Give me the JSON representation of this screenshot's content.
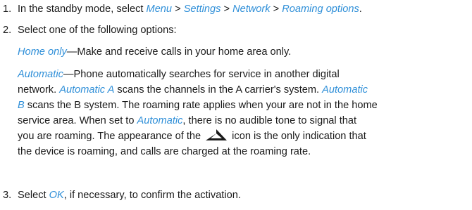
{
  "steps": [
    {
      "number": "1.",
      "parts": [
        {
          "t": "In the standby mode, select "
        },
        {
          "t": "Menu",
          "link": true
        },
        {
          "t": " > "
        },
        {
          "t": "Settings",
          "link": true
        },
        {
          "t": " > "
        },
        {
          "t": "Network",
          "link": true
        },
        {
          "t": " > "
        },
        {
          "t": "Roaming options",
          "link": true
        },
        {
          "t": "."
        }
      ]
    },
    {
      "number": "2.",
      "parts": [
        {
          "t": "Select one of the following options:"
        }
      ]
    },
    {
      "number": "3.",
      "parts": [
        {
          "t": "Select "
        },
        {
          "t": "OK",
          "link": true
        },
        {
          "t": ", if necessary, to confirm the activation."
        }
      ]
    }
  ],
  "options": [
    {
      "lines": [
        [
          {
            "t": "Home only",
            "link": true
          },
          {
            "t": "—Make and receive calls in your home area only."
          }
        ]
      ]
    },
    {
      "lines": [
        [
          {
            "t": "Automatic",
            "link": true
          },
          {
            "t": "—Phone automatically searches for service in another digital"
          }
        ],
        [
          {
            "t": "network. "
          },
          {
            "t": "Automatic A",
            "link": true
          },
          {
            "t": " scans the channels in the A carrier's system. "
          },
          {
            "t": "Automatic",
            "link": true
          }
        ],
        [
          {
            "t": "B",
            "link": true
          },
          {
            "t": " scans the B system. The roaming rate applies when your are not in the home"
          }
        ],
        [
          {
            "t": "service area. When set to "
          },
          {
            "t": "Automatic",
            "link": true
          },
          {
            "t": ", there is no audible tone to signal that"
          }
        ],
        [
          {
            "t": "you are roaming. The appearance of the"
          },
          {
            "icon": "roaming-triangle-icon"
          },
          {
            "t": "icon is the only indication that"
          }
        ],
        [
          {
            "t": "the device is roaming, and calls are charged at the roaming rate."
          }
        ]
      ]
    }
  ],
  "colors": {
    "link": "#2f8fd8",
    "text": "#1a1a1a",
    "icon": "#1a1a1a"
  }
}
